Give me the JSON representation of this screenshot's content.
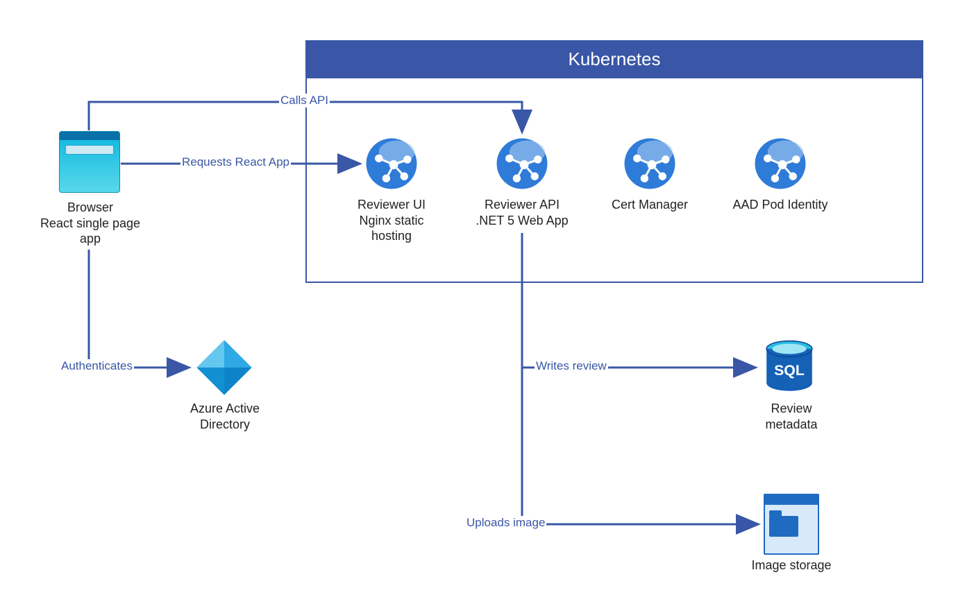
{
  "container": {
    "title": "Kubernetes"
  },
  "nodes": {
    "browser": {
      "label": "Browser\nReact single page\napp"
    },
    "reviewer_ui": {
      "label": "Reviewer UI\nNginx static\nhosting"
    },
    "reviewer_api": {
      "label": "Reviewer API\n.NET 5 Web App"
    },
    "cert_manager": {
      "label": "Cert Manager"
    },
    "aad_pod": {
      "label": "AAD Pod Identity"
    },
    "aad": {
      "label": "Azure Active\nDirectory"
    },
    "sql": {
      "label": "Review\nmetadata",
      "icon_text": "SQL"
    },
    "storage": {
      "label": "Image storage"
    }
  },
  "edges": {
    "calls_api": "Calls API",
    "requests_app": "Requests React App",
    "authenticates": "Authenticates",
    "writes_review": "Writes review",
    "uploads_image": "Uploads image"
  }
}
